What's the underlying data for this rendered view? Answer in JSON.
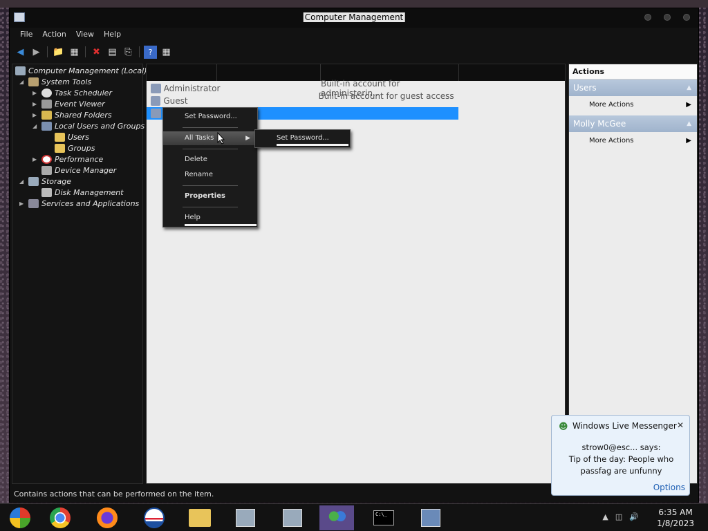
{
  "window": {
    "title": "Computer Management",
    "menu": [
      "File",
      "Action",
      "View",
      "Help"
    ]
  },
  "toolbar": {
    "icons": [
      "back-icon",
      "forward-icon",
      "up-folder-icon",
      "show-hide-tree-icon",
      "delete-icon",
      "properties-icon",
      "export-icon",
      "help-icon",
      "show-hide-action-pane-icon"
    ]
  },
  "tree": {
    "root": "Computer Management (Local)",
    "system_tools": "System Tools",
    "task_scheduler": "Task Scheduler",
    "event_viewer": "Event Viewer",
    "shared_folders": "Shared Folders",
    "local_users_groups": "Local Users and Groups",
    "users": "Users",
    "groups": "Groups",
    "performance": "Performance",
    "device_manager": "Device Manager",
    "storage": "Storage",
    "disk_management": "Disk Management",
    "services_apps": "Services and Applications"
  },
  "list": {
    "rows": [
      {
        "name": "Administrator",
        "description": "Built-in account for administerin..."
      },
      {
        "name": "Guest",
        "description": "Built-in account for guest access ..."
      }
    ]
  },
  "actions": {
    "title": "Actions",
    "section1": "Users",
    "section1_item": "More Actions",
    "section2": "Molly McGee",
    "section2_item": "More Actions"
  },
  "context_menu": {
    "set_password": "Set Password...",
    "all_tasks": "All Tasks",
    "delete": "Delete",
    "rename": "Rename",
    "properties": "Properties",
    "help": "Help"
  },
  "submenu": {
    "set_password": "Set Password..."
  },
  "status": "Contains actions that can be performed on the item.",
  "toast": {
    "title": "Windows Live Messenger",
    "sender": "strow0@esc... says:",
    "message": "Tip of the day: People who passfag are unfunny",
    "options": "Options"
  },
  "clock": {
    "time": "6:35 AM",
    "date": "1/8/2023"
  }
}
